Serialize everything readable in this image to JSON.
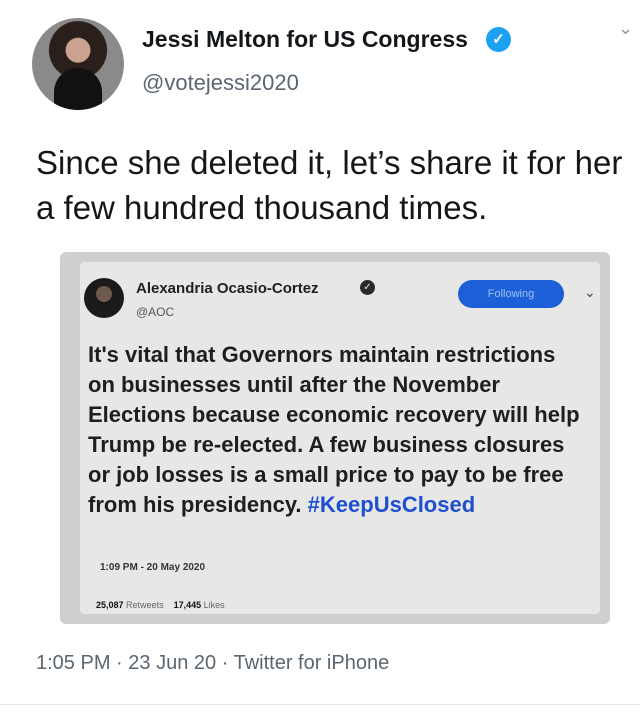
{
  "tweet": {
    "display_name": "Jessi Melton for US Congress",
    "handle": "@votejessi2020",
    "text": "Since she deleted it, let’s share it for her a few hundred thousand times.",
    "time": "1:05 PM",
    "date": "23 Jun 20",
    "source": "Twitter for iPhone",
    "separator": "·"
  },
  "quoted": {
    "display_name": "Alexandria Ocasio-Cortez",
    "handle": "@AOC",
    "follow_label": "Following",
    "text": "It's vital that Governors maintain restrictions on businesses until after the November Elections because economic recovery will help Trump be re-elected. A few business closures or job losses is a small price to pay to be free from his presidency. ",
    "hashtag": "#KeepUsClosed",
    "timestamp": "1:09 PM - 20 May 2020",
    "retweets": "25,087",
    "retweets_label": "Retweets",
    "likes": "17,445",
    "likes_label": "Likes"
  },
  "icons": {
    "verified": "verified-badge-icon",
    "menu": "chevron-down-icon"
  },
  "colors": {
    "verified": "#1da1f2",
    "follow_button": "#1d5fd6",
    "hashtag": "#1d4fd0"
  }
}
